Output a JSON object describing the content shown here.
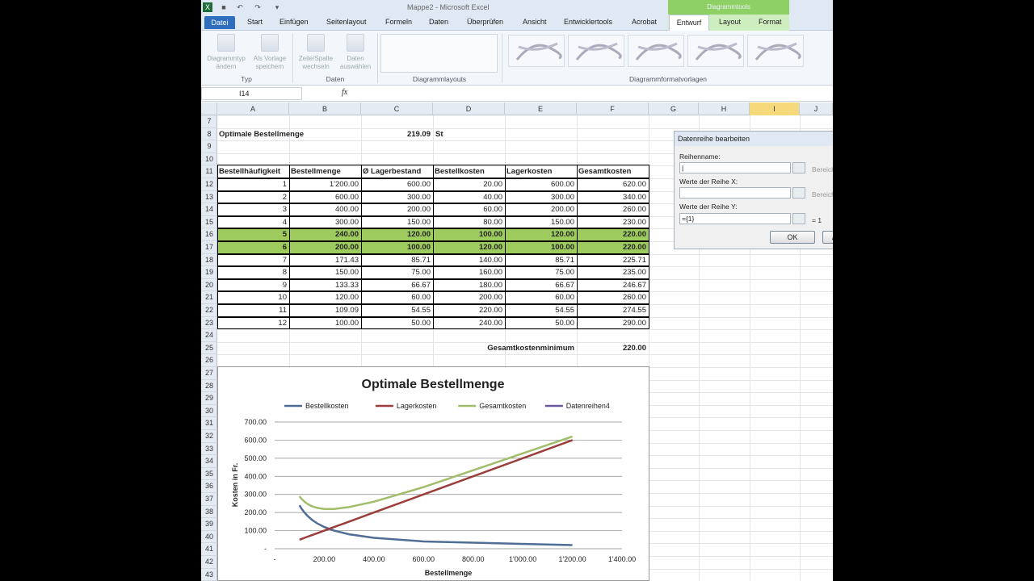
{
  "window": {
    "title": "Mappe2 - Microsoft Excel",
    "context_tools": "Diagrammtools"
  },
  "tabs": [
    "Datei",
    "Start",
    "Einfügen",
    "Seitenlayout",
    "Formeln",
    "Daten",
    "Überprüfen",
    "Ansicht",
    "Entwicklertools",
    "Acrobat",
    "Entwurf",
    "Layout",
    "Format"
  ],
  "ribbon": {
    "btn_type_change": [
      "Diagrammtyp",
      "ändern"
    ],
    "btn_save_template": [
      "Als Vorlage",
      "speichern"
    ],
    "btn_switch_row": [
      "Zeile/Spalte",
      "wechseln"
    ],
    "btn_select_data": [
      "Daten",
      "auswählen"
    ],
    "group_typ": "Typ",
    "group_daten": "Daten",
    "group_layouts": "Diagrammlayouts",
    "group_styles": "Diagrammformatvorlagen"
  },
  "formula_bar": {
    "name_box": "I14",
    "fx": "fx"
  },
  "columns": [
    "A",
    "B",
    "C",
    "D",
    "E",
    "F",
    "G",
    "H",
    "I",
    "J"
  ],
  "rows": [
    "7",
    "8",
    "9",
    "10",
    "11",
    "12",
    "13",
    "14",
    "15",
    "16",
    "17",
    "18",
    "19",
    "20",
    "21",
    "22",
    "23",
    "24",
    "25",
    "26",
    "27",
    "28",
    "29",
    "30",
    "31",
    "32",
    "33",
    "34",
    "35",
    "36",
    "37",
    "38",
    "39",
    "40",
    "41",
    "42",
    "43"
  ],
  "sheet": {
    "title_label": "Optimale Bestellmenge",
    "title_value": "219.09",
    "title_unit": "St",
    "headers": [
      "Bestellhäufigkeit",
      "Bestellmenge",
      "Ø Lagerbestand",
      "Bestellkosten",
      "Lagerkosten",
      "Gesamtkosten"
    ],
    "table": [
      [
        "1",
        "1'200.00",
        "600.00",
        "20.00",
        "600.00",
        "620.00"
      ],
      [
        "2",
        "600.00",
        "300.00",
        "40.00",
        "300.00",
        "340.00"
      ],
      [
        "3",
        "400.00",
        "200.00",
        "60.00",
        "200.00",
        "260.00"
      ],
      [
        "4",
        "300.00",
        "150.00",
        "80.00",
        "150.00",
        "230.00"
      ],
      [
        "5",
        "240.00",
        "120.00",
        "100.00",
        "120.00",
        "220.00"
      ],
      [
        "6",
        "200.00",
        "100.00",
        "120.00",
        "100.00",
        "220.00"
      ],
      [
        "7",
        "171.43",
        "85.71",
        "140.00",
        "85.71",
        "225.71"
      ],
      [
        "8",
        "150.00",
        "75.00",
        "160.00",
        "75.00",
        "235.00"
      ],
      [
        "9",
        "133.33",
        "66.67",
        "180.00",
        "66.67",
        "246.67"
      ],
      [
        "10",
        "120.00",
        "60.00",
        "200.00",
        "60.00",
        "260.00"
      ],
      [
        "11",
        "109.09",
        "54.55",
        "220.00",
        "54.55",
        "274.55"
      ],
      [
        "12",
        "100.00",
        "50.00",
        "240.00",
        "50.00",
        "290.00"
      ]
    ],
    "min_label": "Gesamtkostenminimum",
    "min_value": "220.00"
  },
  "chart_data": {
    "type": "line",
    "title": "Optimale Bestellmenge",
    "xlabel": "Bestellmenge",
    "ylabel": "Kosten in Fr.",
    "xlim": [
      0,
      1400
    ],
    "ylim": [
      0,
      700
    ],
    "x_ticks": [
      "-",
      "200.00",
      "400.00",
      "600.00",
      "800.00",
      "1'000.00",
      "1'200.00",
      "1'400.00"
    ],
    "y_ticks": [
      "-",
      "100.00",
      "200.00",
      "300.00",
      "400.00",
      "500.00",
      "600.00",
      "700.00"
    ],
    "legend_position": "top",
    "x": [
      1200,
      600,
      400,
      300,
      240,
      200,
      171.43,
      150,
      133.33,
      120,
      109.09,
      100
    ],
    "series": [
      {
        "name": "Bestellkosten",
        "color": "#4f6d95",
        "values": [
          20,
          40,
          60,
          80,
          100,
          120,
          140,
          160,
          180,
          200,
          220,
          240
        ]
      },
      {
        "name": "Lagerkosten",
        "color": "#9b3d3a",
        "values": [
          600,
          300,
          200,
          150,
          120,
          100,
          85.71,
          75,
          66.67,
          60,
          54.55,
          50
        ]
      },
      {
        "name": "Gesamtkosten",
        "color": "#a2bd6a",
        "values": [
          620,
          340,
          260,
          230,
          220,
          220,
          225.71,
          235,
          246.67,
          260,
          274.55,
          290
        ]
      },
      {
        "name": "Datenreihen4",
        "color": "#6a58a0",
        "values": []
      }
    ]
  },
  "dialog": {
    "title": "Datenreihe bearbeiten",
    "name_label": "Reihenname:",
    "x_label": "Werte der Reihe X:",
    "y_label": "Werte der Reihe Y:",
    "name_value": "|",
    "x_value": "",
    "y_value": "={1}",
    "side_range_1": "Bereich",
    "side_range_2": "Bereich",
    "side_y": "= 1",
    "ok": "OK",
    "cancel": "A"
  }
}
